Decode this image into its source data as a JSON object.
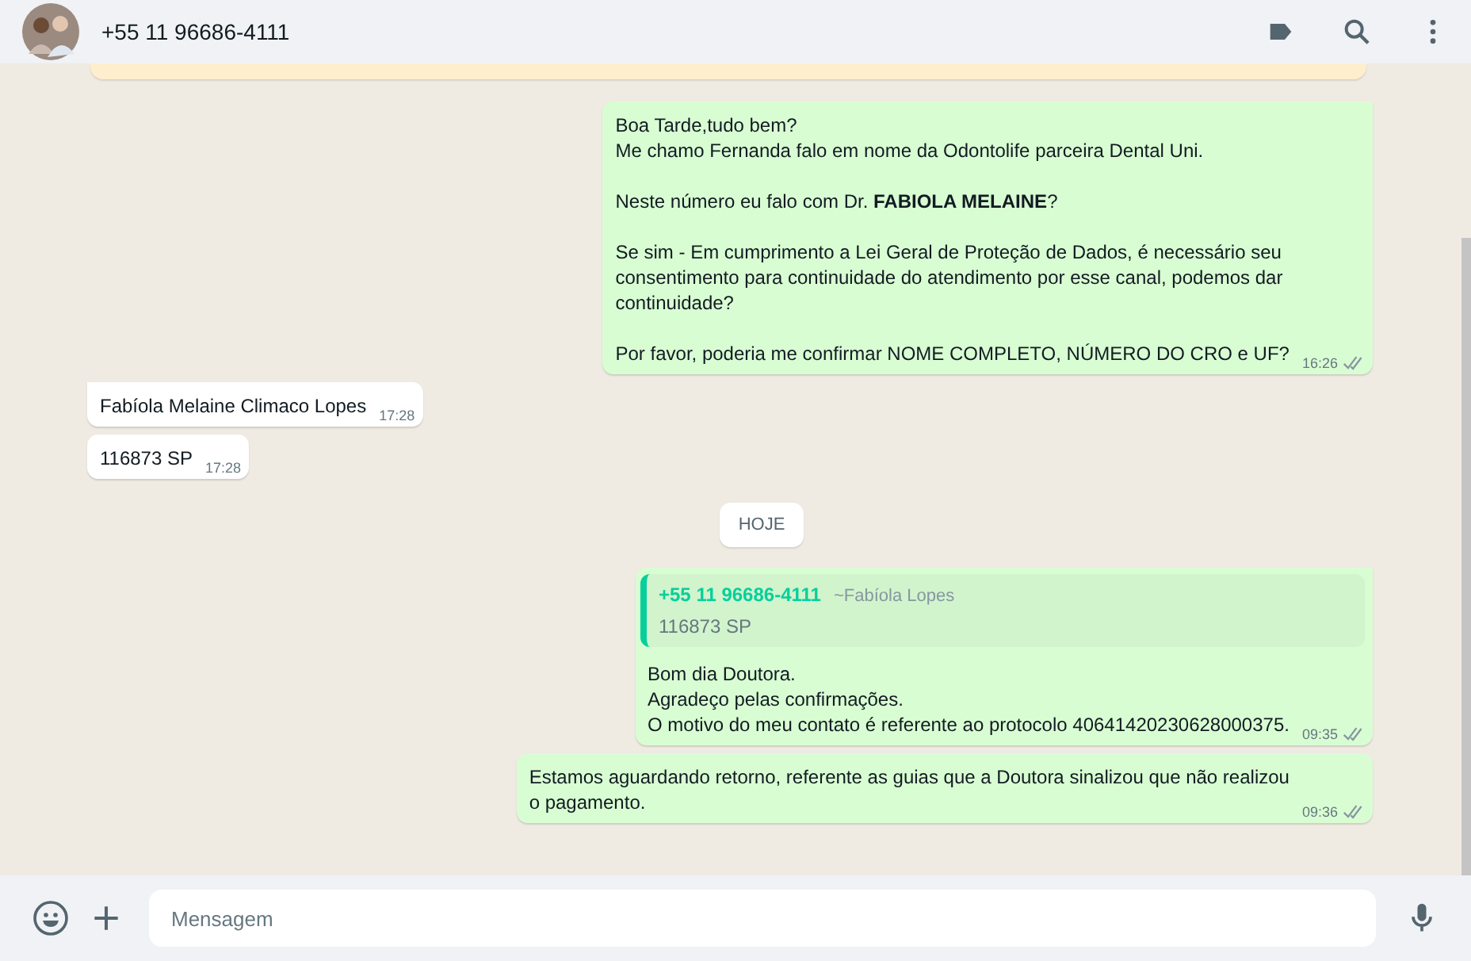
{
  "header": {
    "contact": "+55 11 96686-4111"
  },
  "messages": [
    {
      "kind": "out",
      "text": "Boa Tarde,tudo bem?\nMe chamo Fernanda falo em nome da Odontolife parceira Dental Uni.\n\nNeste número eu falo com Dr. **FABIOLA MELAINE**?\n\nSe sim - Em cumprimento a Lei Geral de Proteção de Dados, é necessário seu\nconsentimento para continuidade do atendimento por esse canal, podemos dar\ncontinuidade?\n\nPor favor, poderia me confirmar NOME COMPLETO, NÚMERO DO CRO e UF?",
      "time": "16:26",
      "delivered": true,
      "tail": true
    },
    {
      "kind": "in",
      "text": "Fabíola Melaine Climaco Lopes",
      "time": "17:28",
      "tail": true
    },
    {
      "kind": "in",
      "text": "116873 SP",
      "time": "17:28",
      "tail": false
    },
    {
      "kind": "date",
      "text": "HOJE"
    },
    {
      "kind": "out",
      "quote": {
        "author": "+55 11 96686-4111",
        "name": "~Fabíola Lopes",
        "text": "116873 SP"
      },
      "text": "Bom dia Doutora.\nAgradeço pelas confirmações.\nO motivo do meu contato é referente ao protocolo 40641420230628000375.",
      "time": "09:35",
      "delivered": true,
      "tail": true
    },
    {
      "kind": "out",
      "text": "Estamos aguardando retorno, referente as guias que a Doutora sinalizou que não realizou\no pagamento.",
      "time": "09:36",
      "delivered": true,
      "tail": false
    }
  ],
  "composer": {
    "placeholder": "Mensagem"
  }
}
